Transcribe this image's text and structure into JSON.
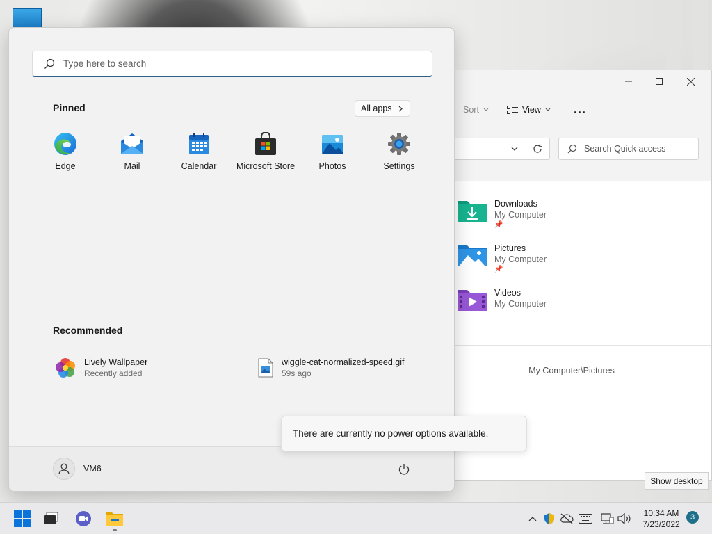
{
  "start_menu": {
    "search_placeholder": "Type here to search",
    "pinned_title": "Pinned",
    "all_apps_label": "All apps",
    "pinned_apps": [
      {
        "label": "Edge",
        "icon": "edge-icon"
      },
      {
        "label": "Mail",
        "icon": "mail-icon"
      },
      {
        "label": "Calendar",
        "icon": "calendar-icon"
      },
      {
        "label": "Microsoft Store",
        "icon": "store-icon"
      },
      {
        "label": "Photos",
        "icon": "photos-icon"
      },
      {
        "label": "Settings",
        "icon": "settings-icon"
      }
    ],
    "recommended_title": "Recommended",
    "recommended": [
      {
        "name": "Lively Wallpaper",
        "detail": "Recently added",
        "icon": "lively-wallpaper-icon"
      },
      {
        "name": "wiggle-cat-normalized-speed.gif",
        "detail": "59s ago",
        "icon": "image-file-icon"
      }
    ],
    "user_name": "VM6"
  },
  "power_tooltip": "There are currently no power options available.",
  "explorer": {
    "toolbar": {
      "sort_label": "Sort",
      "view_label": "View",
      "more_label": "..."
    },
    "search_placeholder": "Search Quick access",
    "items": [
      {
        "name": "Downloads",
        "location": "My Computer",
        "pinned": true,
        "icon": "downloads-folder-icon"
      },
      {
        "name": "Pictures",
        "location": "My Computer",
        "pinned": true,
        "icon": "pictures-folder-icon"
      },
      {
        "name": "Videos",
        "location": "My Computer",
        "pinned": false,
        "icon": "videos-folder-icon"
      }
    ],
    "path_text": "My Computer\\Pictures"
  },
  "taskbar": {
    "time": "10:34 AM",
    "date": "7/23/2022",
    "notification_count": "3",
    "show_desktop_tooltip": "Show desktop"
  },
  "colors": {
    "accent": "#2c5f8a",
    "start_bg": "#f2f2f2",
    "taskbar_bg": "#e9e9ec",
    "badge": "#1d6f8a"
  }
}
